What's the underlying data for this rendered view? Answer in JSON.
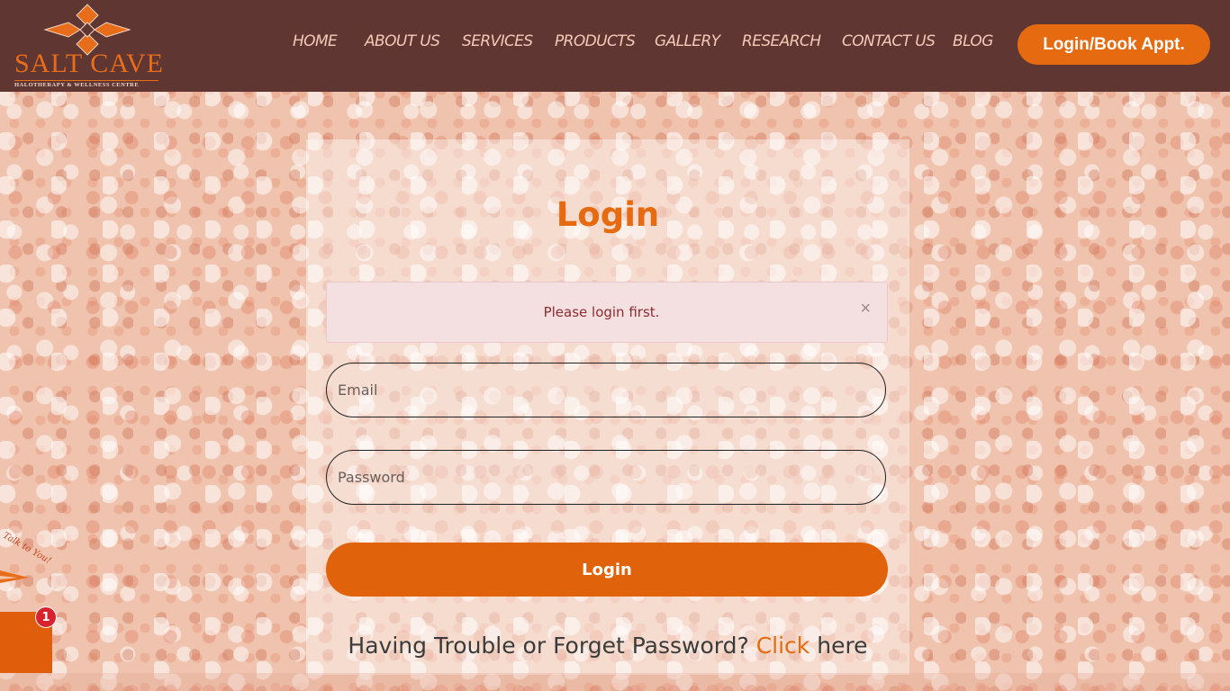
{
  "brand": {
    "name": "SALT CAVE",
    "tagline": "HALOTHERAPY & WELLNESS CENTRE",
    "accent_color": "#e56a10",
    "header_color": "#5f3631"
  },
  "nav": {
    "items": [
      "HOME",
      "ABOUT US",
      "SERVICES",
      "PRODUCTS",
      "GALLERY",
      "RESEARCH",
      "CONTACT US",
      "BLOG"
    ],
    "cta_label": "Login/Book Appt."
  },
  "login": {
    "title": "Login",
    "alert_message": "Please login first.",
    "alert_close": "×",
    "email_placeholder": "Email",
    "password_placeholder": "Password",
    "submit_label": "Login",
    "trouble_text": "Having Trouble or Forget Password?",
    "trouble_link": "Click",
    "trouble_suffix": "here"
  },
  "side_widget": {
    "badge_count": "1",
    "deco_text": "Talk to You!"
  }
}
